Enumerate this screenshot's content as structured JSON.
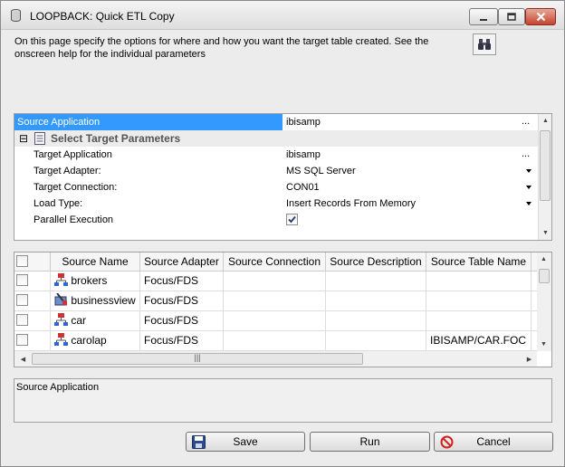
{
  "window": {
    "title": "LOOPBACK: Quick ETL Copy"
  },
  "description": "On this page specify the options for where and how you want the target table created. See the onscreen help for the individual  parameters",
  "properties": {
    "source_application": {
      "label": "Source Application",
      "value": "ibisamp",
      "button": "..."
    },
    "section": {
      "toggle": "⊟",
      "label": "Select Target Parameters"
    },
    "rows": [
      {
        "label": "Target Application",
        "value": "ibisamp",
        "control": "..."
      },
      {
        "label": "Target Adapter:",
        "value": "MS SQL Server",
        "control": "dropdown"
      },
      {
        "label": "Target Connection:",
        "value": "CON01",
        "control": "dropdown"
      },
      {
        "label": "Load Type:",
        "value": "Insert Records From Memory",
        "control": "dropdown"
      },
      {
        "label": "Parallel Execution",
        "value": "",
        "control": "checkbox",
        "checked": true
      }
    ]
  },
  "grid": {
    "columns": [
      "",
      "Source Name",
      "Source Adapter",
      "Source Connection",
      "Source Description",
      "Source Table Name"
    ],
    "rows": [
      {
        "name": "brokers",
        "adapter": "Focus/FDS",
        "connection": "",
        "description": "",
        "table": "",
        "icon": "synonym-icon"
      },
      {
        "name": "businessview",
        "adapter": "Focus/FDS",
        "connection": "",
        "description": "",
        "table": "",
        "icon": "business-view-icon"
      },
      {
        "name": "car",
        "adapter": "Focus/FDS",
        "connection": "",
        "description": "",
        "table": "",
        "icon": "synonym-icon"
      },
      {
        "name": "carolap",
        "adapter": "Focus/FDS",
        "connection": "",
        "description": "",
        "table": "IBISAMP/CAR.FOC",
        "icon": "synonym-icon"
      }
    ]
  },
  "help_text": "Source Application",
  "buttons": {
    "save": "Save",
    "run": "Run",
    "cancel": "Cancel"
  },
  "colors": {
    "selection": "#3399ff",
    "close_button": "#c5442d"
  }
}
